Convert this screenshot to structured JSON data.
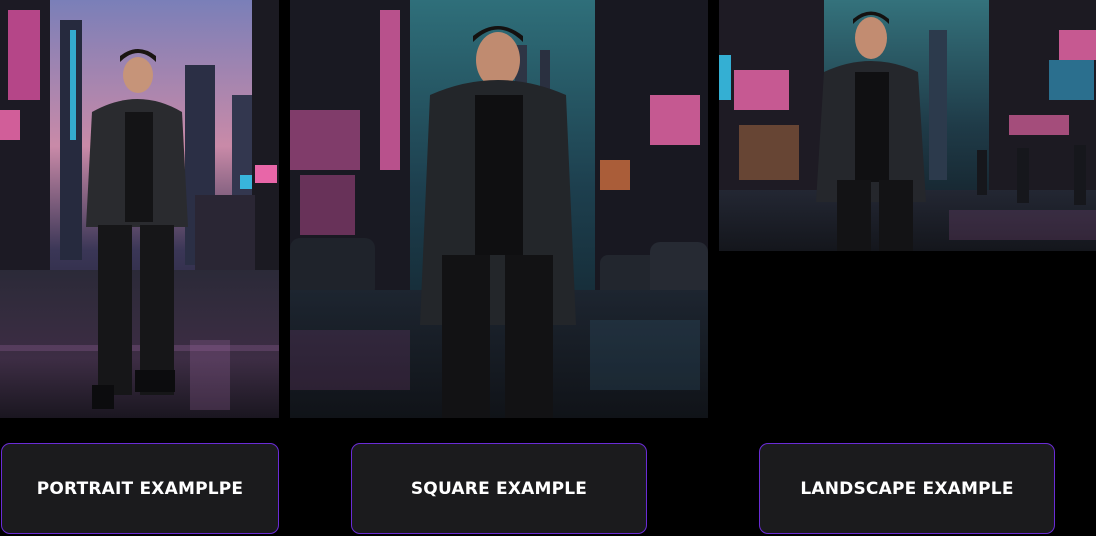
{
  "examples": [
    {
      "id": "portrait",
      "label": "PORTRAIT EXAMPLPE"
    },
    {
      "id": "square",
      "label": "SQUARE EXAMPLE"
    },
    {
      "id": "landscape",
      "label": "LANDSCAPE EXAMPLE"
    }
  ],
  "colors": {
    "page_background": "#000000",
    "button_background": "#1b1b1d",
    "button_border": "#6a2cd6",
    "button_text": "#ffffff",
    "neon_pink": "#ff5fb0",
    "neon_cyan": "#39d5ff"
  }
}
